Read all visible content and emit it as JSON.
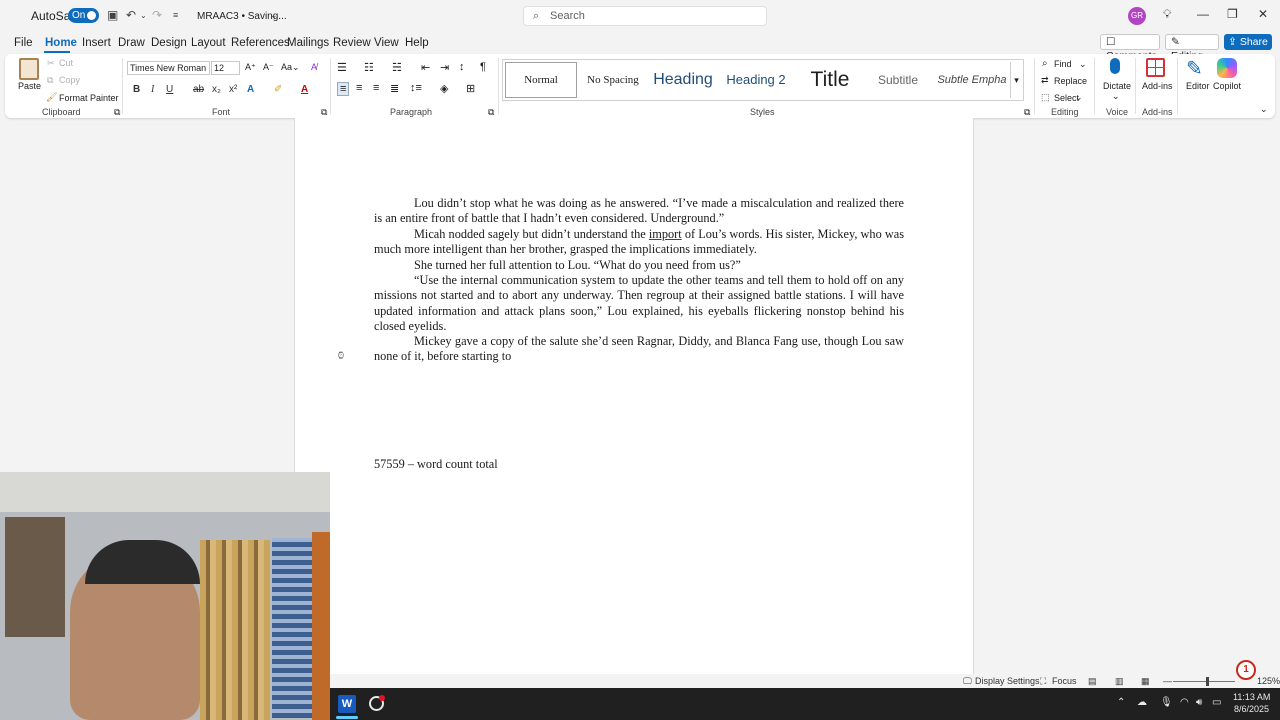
{
  "titlebar": {
    "autosave_label": "AutoSave",
    "autosave_state": "On",
    "doc_title": "MRAAC3 • Saving...",
    "search_placeholder": "Search",
    "avatar_initials": "GR"
  },
  "menu": {
    "items": [
      "File",
      "Home",
      "Insert",
      "Draw",
      "Design",
      "Layout",
      "References",
      "Mailings",
      "Review",
      "View",
      "Help"
    ],
    "active": "Home",
    "comments_label": "Comments",
    "editing_label": "Editing",
    "share_label": "Share"
  },
  "ribbon": {
    "clipboard": {
      "paste": "Paste",
      "cut": "Cut",
      "copy": "Copy",
      "format_painter": "Format Painter",
      "label": "Clipboard"
    },
    "font": {
      "name": "Times New Roman",
      "size": "12",
      "label": "Font"
    },
    "paragraph": {
      "label": "Paragraph"
    },
    "styles": {
      "items": [
        "Normal",
        "No Spacing",
        "Heading",
        "Heading 2",
        "Title",
        "Subtitle",
        "Subtle Empha"
      ],
      "label": "Styles"
    },
    "editing": {
      "find": "Find",
      "replace": "Replace",
      "select": "Select",
      "label": "Editing"
    },
    "voice": {
      "dictate": "Dictate",
      "label": "Voice"
    },
    "addins": {
      "addins": "Add-ins",
      "label": "Add-ins"
    },
    "editor": "Editor",
    "copilot": "Copilot"
  },
  "document": {
    "p1": "Lou didn’t stop what he was doing as he answered. “I’ve made a miscalculation and realized there is an entire front of battle that I hadn’t even considered. Underground.”",
    "p2_before": "Micah nodded sagely but didn’t understand the ",
    "p2_underlined": "import",
    "p2_after": " of Lou’s words. His sister, Mickey, who was much more intelligent than her brother, grasped the implications immediately.",
    "p3": "She turned her full attention to Lou. “What do you need from us?”",
    "p4": "“Use the internal communication system to update the other teams and tell them to hold off on any missions not started and to abort any underway. Then regroup at their assigned battle stations. I will have updated information and attack plans soon,” Lou explained, his eyeballs flickering nonstop behind his closed eyelids.",
    "p5": "Mickey gave a copy of the salute she’d seen Ragnar, Diddy, and Blanca Fang use, though Lou saw none of it, before starting to",
    "word_count": "57559 – word count total"
  },
  "statusbar": {
    "display_settings": "Display Settings",
    "focus": "Focus",
    "zoom": "125%"
  },
  "taskbar": {
    "time": "11:13 AM",
    "date": "8/6/2025"
  },
  "notification_badge": "1",
  "colors": {
    "accent": "#0f6cbd",
    "avatar": "#b146c2",
    "taskbar": "#202020"
  }
}
